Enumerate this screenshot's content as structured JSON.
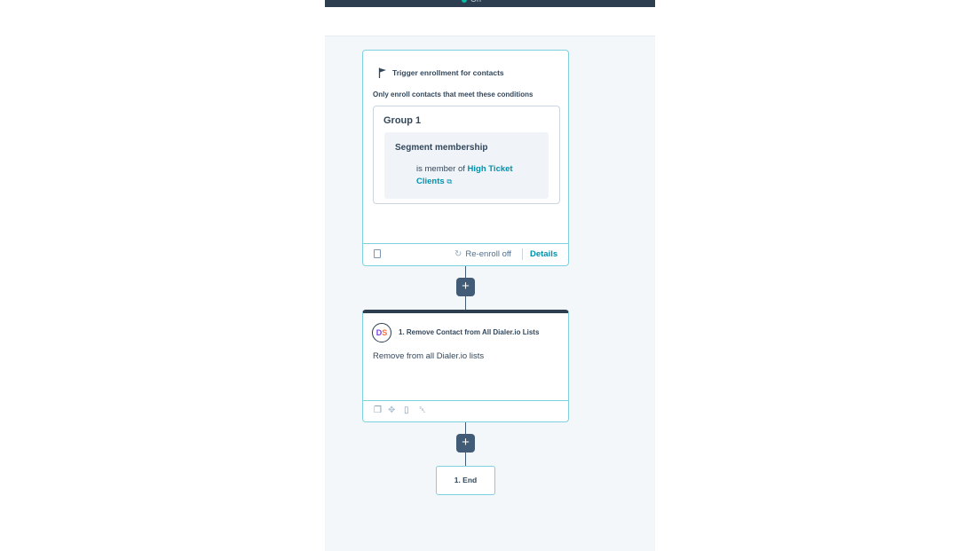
{
  "topbar": {
    "status_label": "On"
  },
  "trigger": {
    "title": "Trigger enrollment for contacts",
    "subtitle": "Only enroll contacts that meet these conditions",
    "group": {
      "title": "Group 1",
      "filter": {
        "title": "Segment membership",
        "operator": "is member of",
        "segment_name": "High Ticket Clients"
      }
    },
    "footer": {
      "reenroll_label": "Re-enroll off",
      "details_label": "Details"
    }
  },
  "add_step_button_label": "+",
  "action": {
    "logo_text_d": "D",
    "logo_text_s": "S",
    "title": "1. Remove Contact from All Dialer.io Lists",
    "description": "Remove from all Dialer.io lists"
  },
  "end_node": {
    "label": "1. End"
  },
  "colors": {
    "accent": "#0091ae",
    "card_border": "#7fd1de",
    "dark_navy": "#2d3e50",
    "canvas_bg": "#f3f7fa"
  },
  "icons": {
    "flag": "flag-icon",
    "clipboard": "clipboard-icon",
    "sync": "sync-icon",
    "external_link": "external-link-icon",
    "copy": "copy-icon",
    "move": "move-icon",
    "trash": "trash-icon"
  }
}
